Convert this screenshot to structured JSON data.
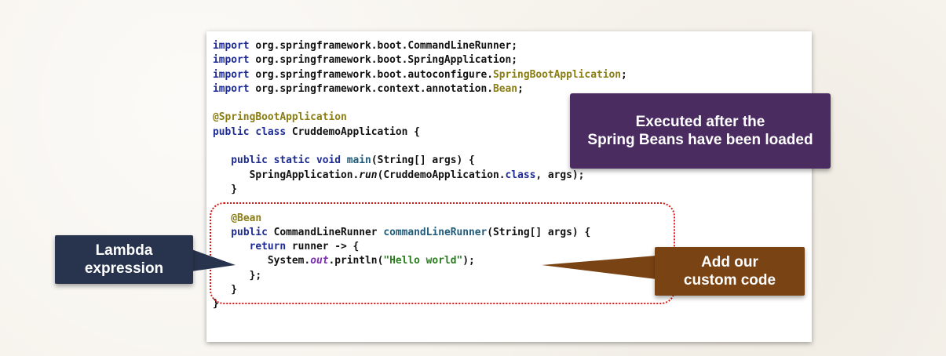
{
  "code_lines": [
    [
      {
        "t": "import",
        "c": "kw"
      },
      {
        "t": " org.springframework.boot.CommandLineRunner;"
      }
    ],
    [
      {
        "t": "import",
        "c": "kw"
      },
      {
        "t": " org.springframework.boot.SpringApplication;"
      }
    ],
    [
      {
        "t": "import",
        "c": "kw"
      },
      {
        "t": " org.springframework.boot.autoconfigure."
      },
      {
        "t": "SpringBootApplication",
        "c": "ann"
      },
      {
        "t": ";"
      }
    ],
    [
      {
        "t": "import",
        "c": "kw"
      },
      {
        "t": " org.springframework.context.annotation."
      },
      {
        "t": "Bean",
        "c": "ann"
      },
      {
        "t": ";"
      }
    ],
    [],
    [
      {
        "t": "@SpringBootApplication",
        "c": "ann"
      }
    ],
    [
      {
        "t": "public class",
        "c": "kw"
      },
      {
        "t": " CruddemoApplication {"
      }
    ],
    [],
    [
      {
        "t": "   "
      },
      {
        "t": "public static void",
        "c": "kw"
      },
      {
        "t": " "
      },
      {
        "t": "main",
        "c": "mth"
      },
      {
        "t": "(String[] args) {"
      }
    ],
    [
      {
        "t": "      SpringApplication."
      },
      {
        "t": "run",
        "c": "it"
      },
      {
        "t": "(CruddemoApplication."
      },
      {
        "t": "class",
        "c": "kw"
      },
      {
        "t": ", args);"
      }
    ],
    [
      {
        "t": "   }"
      }
    ],
    [],
    [
      {
        "t": "   "
      },
      {
        "t": "@Bean",
        "c": "ann"
      }
    ],
    [
      {
        "t": "   "
      },
      {
        "t": "public",
        "c": "kw"
      },
      {
        "t": " CommandLineRunner "
      },
      {
        "t": "commandLineRunner",
        "c": "mth"
      },
      {
        "t": "(String[] args) {"
      }
    ],
    [
      {
        "t": "      "
      },
      {
        "t": "return",
        "c": "kw"
      },
      {
        "t": " runner -> {"
      }
    ],
    [
      {
        "t": "         System."
      },
      {
        "t": "out",
        "c": "fld"
      },
      {
        "t": ".println("
      },
      {
        "t": "\"Hello world\"",
        "c": "str"
      },
      {
        "t": ");"
      }
    ],
    [
      {
        "t": "      };"
      }
    ],
    [
      {
        "t": "   }"
      }
    ],
    [
      {
        "t": "}"
      }
    ]
  ],
  "callouts": {
    "executed": {
      "line1": "Executed after the",
      "line2": "Spring Beans have been loaded"
    },
    "lambda": {
      "line1": "Lambda",
      "line2": "expression"
    },
    "custom": {
      "line1": "Add our",
      "line2": "custom code"
    }
  },
  "colors": {
    "keyword": "#1d2b92",
    "annotation": "#8a7d12",
    "string": "#2a7d1f",
    "callout_purple": "#4a2c60",
    "callout_navy": "#28344d",
    "callout_brown": "#7a4314",
    "dotted_border": "#e01414"
  }
}
